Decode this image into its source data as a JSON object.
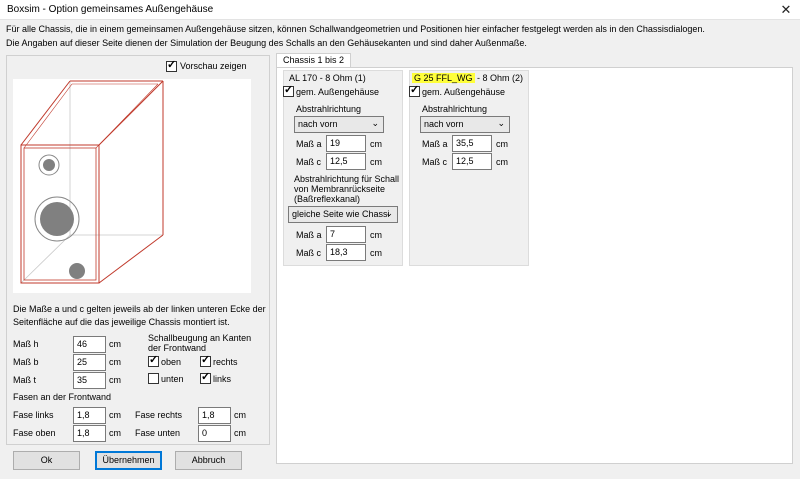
{
  "window": {
    "title": "Boxsim - Option gemeinsames Außengehäuse",
    "close_icon": "close-icon"
  },
  "intro": {
    "line1": "Für alle Chassis, die in einem gemeinsamen Außengehäuse sitzen, können Schallwandgeometrien und Positionen hier einfacher festgelegt werden als in den Chassisdialogen.",
    "line2": "Die Angaben auf dieser Seite dienen der Simulation der  Beugung des Schalls an den Gehäusekanten und sind daher Außenmaße."
  },
  "left": {
    "preview_label": "Vorschau zeigen",
    "preview_checked": true,
    "note_line1": "Die Maße a und c gelten jeweils ab der linken unteren Ecke der",
    "note_line2": "Seitenfläche auf die das jeweilige Chassis montiert ist.",
    "dims": [
      {
        "label": "Maß h",
        "value": "46",
        "unit": "cm"
      },
      {
        "label": "Maß b",
        "value": "25",
        "unit": "cm"
      },
      {
        "label": "Maß t",
        "value": "35",
        "unit": "cm"
      }
    ],
    "diffraction": {
      "title_line1": "Schallbeugung an Kanten",
      "title_line2": "der Frontwand",
      "oben": "oben",
      "rechts": "rechts",
      "unten": "unten",
      "links": "links",
      "oben_checked": true,
      "rechts_checked": true,
      "unten_checked": false,
      "links_checked": true
    },
    "fasen_title": "Fasen an der Frontwand",
    "fasen": {
      "links_label": "Fase links",
      "links_value": "1,8",
      "links_unit": "cm",
      "rechts_label": "Fase rechts",
      "rechts_value": "1,8",
      "rechts_unit": "cm",
      "oben_label": "Fase oben",
      "oben_value": "1,8",
      "oben_unit": "cm",
      "unten_label": "Fase unten",
      "unten_value": "0",
      "unten_unit": "cm"
    },
    "buttons": {
      "ok": "Ok",
      "apply": "Übernehmen",
      "cancel": "Abbruch"
    }
  },
  "tabs": {
    "active": "Chassis 1 bis 2"
  },
  "chassis1": {
    "title": "AL 170 - 8 Ohm (1)",
    "common_label": "gem. Außengehäuse",
    "common_checked": true,
    "direction_label": "Abstrahlrichtung",
    "direction_value": "nach vorn",
    "a_label": "Maß a",
    "a_value": "19",
    "a_unit": "cm",
    "c_label": "Maß c",
    "c_value": "12,5",
    "c_unit": "cm",
    "rear_line1": "Abstrahlrichtung für Schall",
    "rear_line2": "von Membranrückseite",
    "rear_line3": "(Baßreflexkanal)",
    "rear_direction_value": "gleiche Seite wie Chassi",
    "ra_label": "Maß a",
    "ra_value": "7",
    "ra_unit": "cm",
    "rc_label": "Maß c",
    "rc_value": "18,3",
    "rc_unit": "cm"
  },
  "chassis2": {
    "title_highlight": "G 25 FFL_WG",
    "title_rest": " - 8 Ohm (2)",
    "highlight_color": "#ffff3a",
    "common_label": "gem. Außengehäuse",
    "common_checked": true,
    "direction_label": "Abstrahlrichtung",
    "direction_value": "nach vorn",
    "a_label": "Maß a",
    "a_value": "35,5",
    "a_unit": "cm",
    "c_label": "Maß c",
    "c_value": "12,5",
    "c_unit": "cm"
  },
  "colors": {
    "box_outline": "#c0392b",
    "driver_fill": "#808080"
  }
}
